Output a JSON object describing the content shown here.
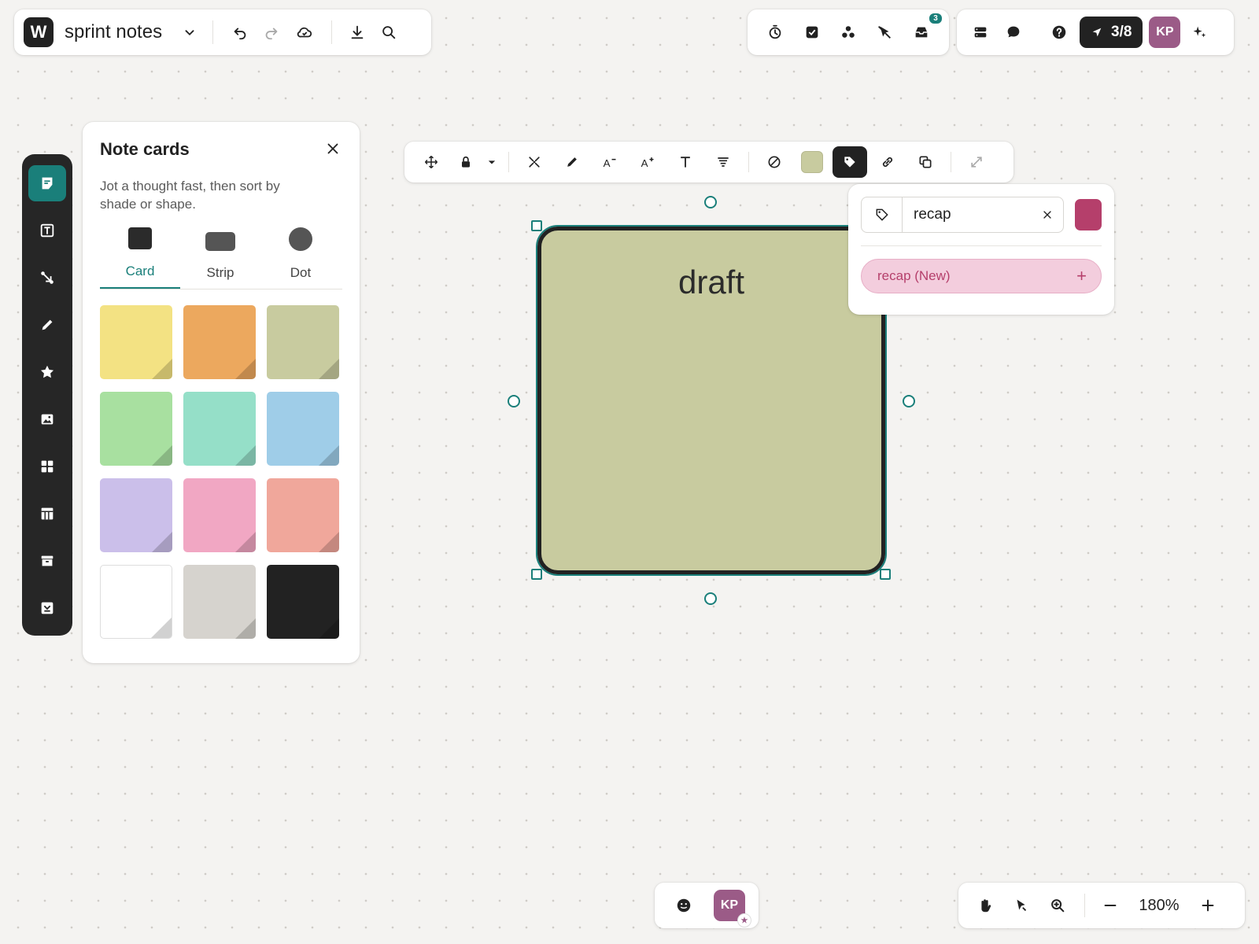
{
  "board": {
    "logo_letter": "W",
    "title": "sprint notes"
  },
  "header": {
    "inbox_badge": "3",
    "counter": "3/8",
    "avatar_initials": "KP"
  },
  "note_panel": {
    "title": "Note cards",
    "description": "Jot a thought fast, then sort by shade or shape.",
    "shapes": [
      "Card",
      "Strip",
      "Dot"
    ],
    "active_shape": "Card",
    "swatch_colors": [
      "#f3e283",
      "#eca85e",
      "#c8cb9f",
      "#a8e0a0",
      "#95dfc8",
      "#9fcde8",
      "#cbbfea",
      "#f1a7c3",
      "#f0a79b",
      "#ffffff",
      "#d6d3ce",
      "#222222"
    ]
  },
  "toolbar": {
    "fill_color": "#c8cb9f"
  },
  "sticky": {
    "text": "draft",
    "color": "#c8cb9f"
  },
  "tag_popover": {
    "value": "recap",
    "color": "#b53f6b",
    "suggestion": "recap (New)"
  },
  "zoom": {
    "level": "180%"
  },
  "colors": {
    "accent": "#1a7f7a",
    "tag": "#b53f6b",
    "dark": "#222222"
  }
}
